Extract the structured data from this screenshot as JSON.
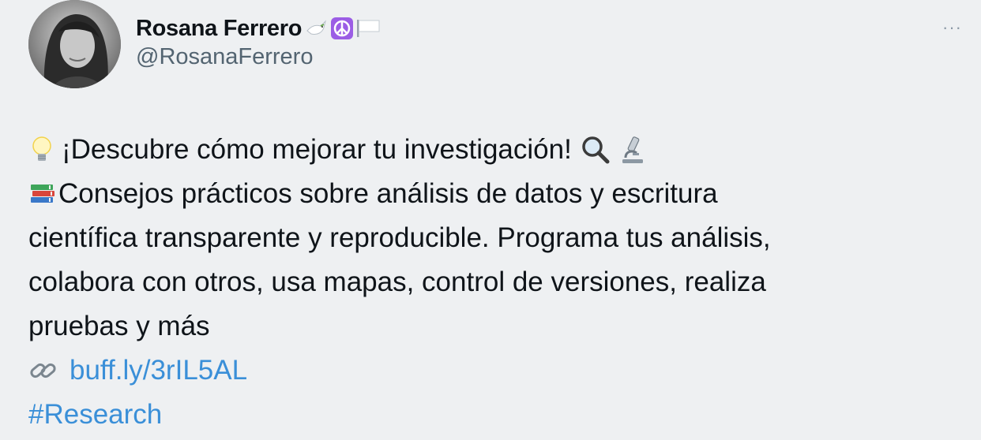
{
  "author": {
    "display_name": "Rosana Ferrero",
    "handle": "@RosanaFerrero",
    "name_emojis": [
      "dove-icon",
      "peace-symbol-icon",
      "white-flag-icon"
    ]
  },
  "more_label": "···",
  "tweet": {
    "line1": "¡Descubre cómo mejorar tu investigación!",
    "line2": "Consejos prácticos sobre análisis de datos y escritura",
    "line3": "científica transparente y reproducible. Programa tus análisis,",
    "line4": "colabora con otros, usa mapas, control de versiones, realiza",
    "line5": "pruebas y más",
    "link": "buff.ly/3rIL5AL",
    "hashtag": "#Research"
  },
  "colors": {
    "background": "#eef0f2",
    "link": "#3a8fd8",
    "handle": "#536471"
  }
}
